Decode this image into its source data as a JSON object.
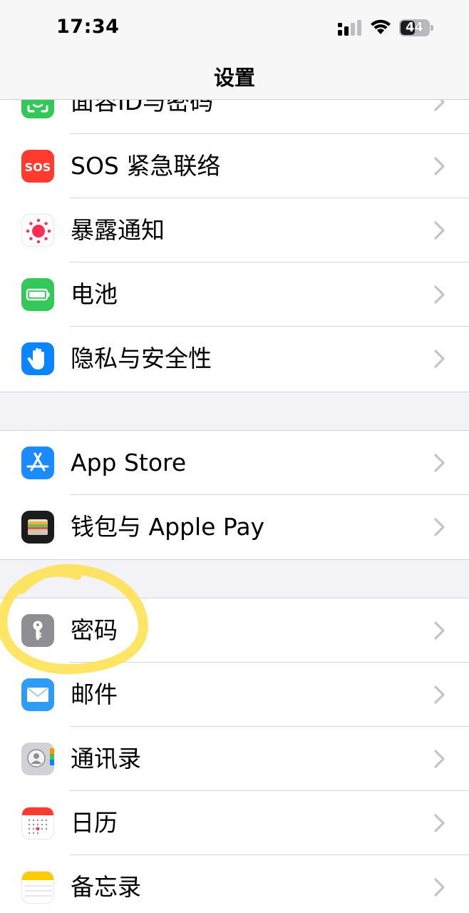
{
  "status_bar": {
    "time": "17:34",
    "battery_level": "44",
    "signal_icon": "cellular-signal-icon",
    "wifi_icon": "wifi-icon"
  },
  "nav": {
    "title": "设置"
  },
  "colors": {
    "face_id": "#34c759",
    "sos": "#ff3b30",
    "exposure": "#ff2d55",
    "battery": "#34c759",
    "privacy": "#0a84ff",
    "app_store": "#1a8cff",
    "wallet": "#1c1c1e",
    "passwords": "#8e8e93",
    "mail": "#2e9bf5",
    "contacts": "#d1d1d6",
    "calendar": "#ff3b30",
    "notes": "#ffcc00",
    "highlight": "#ffe04a"
  },
  "groups": [
    {
      "items": [
        {
          "label": "面容ID与密码",
          "icon": "face-id-icon"
        },
        {
          "label": "SOS 紧急联络",
          "icon": "sos-icon"
        },
        {
          "label": "暴露通知",
          "icon": "exposure-notification-icon"
        },
        {
          "label": "电池",
          "icon": "battery-icon"
        },
        {
          "label": "隐私与安全性",
          "icon": "privacy-hand-icon"
        }
      ]
    },
    {
      "items": [
        {
          "label": "App Store",
          "icon": "app-store-icon"
        },
        {
          "label": "钱包与 Apple Pay",
          "icon": "wallet-icon"
        }
      ]
    },
    {
      "items": [
        {
          "label": "密码",
          "icon": "key-icon"
        },
        {
          "label": "邮件",
          "icon": "mail-icon"
        },
        {
          "label": "通讯录",
          "icon": "contacts-icon"
        },
        {
          "label": "日历",
          "icon": "calendar-icon"
        },
        {
          "label": "备忘录",
          "icon": "notes-icon"
        }
      ]
    }
  ]
}
